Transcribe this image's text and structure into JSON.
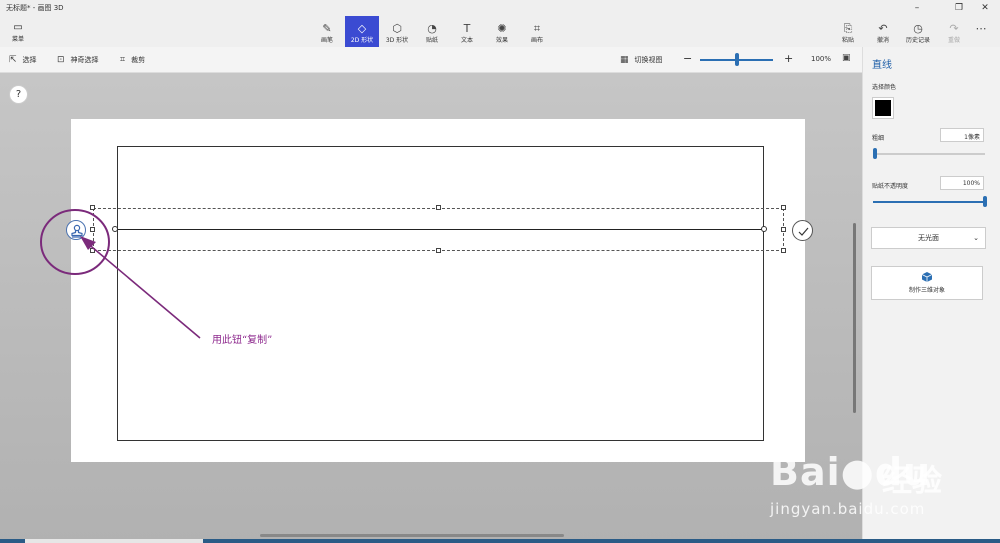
{
  "window": {
    "title": "无标题* - 画图 3D",
    "minimize": "–",
    "maximize": "❐",
    "close": "✕"
  },
  "ribbon": {
    "menu_label": "菜单",
    "tools": [
      {
        "label": "画笔",
        "icon": "brush-icon",
        "glyph": "✎"
      },
      {
        "label": "2D 形状",
        "icon": "shapes-2d-icon",
        "glyph": "◇",
        "active": true
      },
      {
        "label": "3D 形状",
        "icon": "cube-icon",
        "glyph": "⬡"
      },
      {
        "label": "贴纸",
        "icon": "sticker-icon",
        "glyph": "◔"
      },
      {
        "label": "文本",
        "icon": "text-icon",
        "glyph": "T"
      },
      {
        "label": "效果",
        "icon": "effects-icon",
        "glyph": "✺"
      },
      {
        "label": "画布",
        "icon": "canvas-icon",
        "glyph": "⌗"
      }
    ],
    "right_tools": [
      {
        "label": "粘贴",
        "icon": "paste-icon",
        "glyph": "⎘"
      },
      {
        "label": "撤消",
        "icon": "undo-icon",
        "glyph": "↶"
      },
      {
        "label": "历史记录",
        "icon": "history-icon",
        "glyph": "◷"
      },
      {
        "label": "重做",
        "icon": "redo-icon",
        "glyph": "↷",
        "disabled": true
      }
    ],
    "more": "⋯"
  },
  "toolbar": {
    "select_label": "选择",
    "magic_select_label": "神奇选择",
    "crop_label": "裁剪",
    "toggle_view_label": "切换视图",
    "zoom_out": "−",
    "zoom_in": "+",
    "zoom_level": "100%",
    "zoom_fraction": 0.5
  },
  "canvas": {
    "help": "?"
  },
  "annotation": {
    "text": "用此钮“复制”",
    "color": "#8e2a8e"
  },
  "side_panel": {
    "title": "直线",
    "color_label": "选择颜色",
    "color_value": "#000000",
    "thickness_label": "粗细",
    "thickness_value": "1像素",
    "thickness_fraction": 0.02,
    "opacity_label": "贴纸不透明度",
    "opacity_value": "100%",
    "opacity_fraction": 1.0,
    "finish_value": "无光面",
    "make_3d_label": "制作三维对象"
  },
  "watermark": {
    "brand": "Bai",
    "brand_tail": "du",
    "cn": "经验",
    "url": "jingyan.baidu.com"
  }
}
